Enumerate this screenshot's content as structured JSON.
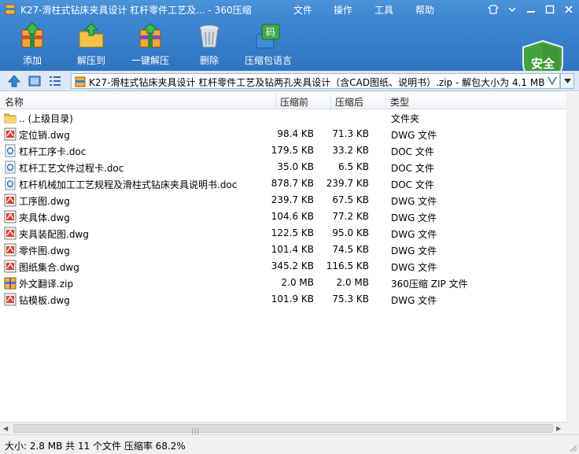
{
  "window": {
    "title": "K27-滑柱式钻床夹具设计 杠杆零件工艺及... - 360压缩",
    "menu": [
      "文件",
      "操作",
      "工具",
      "帮助"
    ],
    "shield_label": "安全"
  },
  "toolbar": [
    {
      "label": "添加",
      "icon": "add-archive-icon"
    },
    {
      "label": "解压到",
      "icon": "extract-to-icon"
    },
    {
      "label": "一键解压",
      "icon": "one-click-extract-icon"
    },
    {
      "label": "删除",
      "icon": "trash-icon"
    },
    {
      "label": "压缩包语言",
      "icon": "archive-language-icon"
    }
  ],
  "address": {
    "path": "K27-滑柱式钻床夹具设计 杠杆零件工艺及钻两孔夹具设计（含CAD图纸、说明书）.zip - 解包大小为 4.1 MB"
  },
  "columns": {
    "name": "名称",
    "size": "压缩前",
    "packed": "压缩后",
    "type": "类型"
  },
  "files": [
    {
      "name": ".. (上级目录)",
      "size": "",
      "packed": "",
      "type": "文件夹",
      "icon": "folder"
    },
    {
      "name": "定位销.dwg",
      "size": "98.4 KB",
      "packed": "71.3 KB",
      "type": "DWG 文件",
      "icon": "dwg"
    },
    {
      "name": "杠杆工序卡.doc",
      "size": "179.5 KB",
      "packed": "33.2 KB",
      "type": "DOC 文件",
      "icon": "doc"
    },
    {
      "name": "杠杆工艺文件过程卡.doc",
      "size": "35.0 KB",
      "packed": "6.5 KB",
      "type": "DOC 文件",
      "icon": "doc"
    },
    {
      "name": "杠杆机械加工工艺规程及滑柱式钻床夹具说明书.doc",
      "size": "878.7 KB",
      "packed": "239.7 KB",
      "type": "DOC 文件",
      "icon": "doc"
    },
    {
      "name": "工序图.dwg",
      "size": "239.7 KB",
      "packed": "67.5 KB",
      "type": "DWG 文件",
      "icon": "dwg"
    },
    {
      "name": "夹具体.dwg",
      "size": "104.6 KB",
      "packed": "77.2 KB",
      "type": "DWG 文件",
      "icon": "dwg"
    },
    {
      "name": "夹具装配图.dwg",
      "size": "122.5 KB",
      "packed": "95.0 KB",
      "type": "DWG 文件",
      "icon": "dwg"
    },
    {
      "name": "零件图.dwg",
      "size": "101.4 KB",
      "packed": "74.5 KB",
      "type": "DWG 文件",
      "icon": "dwg"
    },
    {
      "name": "图纸集合.dwg",
      "size": "345.2 KB",
      "packed": "116.5 KB",
      "type": "DWG 文件",
      "icon": "dwg"
    },
    {
      "name": "外文翻译.zip",
      "size": "2.0 MB",
      "packed": "2.0 MB",
      "type": "360压缩 ZIP 文件",
      "icon": "zip"
    },
    {
      "name": "钻模板.dwg",
      "size": "101.9 KB",
      "packed": "75.3 KB",
      "type": "DWG 文件",
      "icon": "dwg"
    }
  ],
  "status": "大小: 2.8 MB 共 11 个文件 压缩率 68.2%"
}
